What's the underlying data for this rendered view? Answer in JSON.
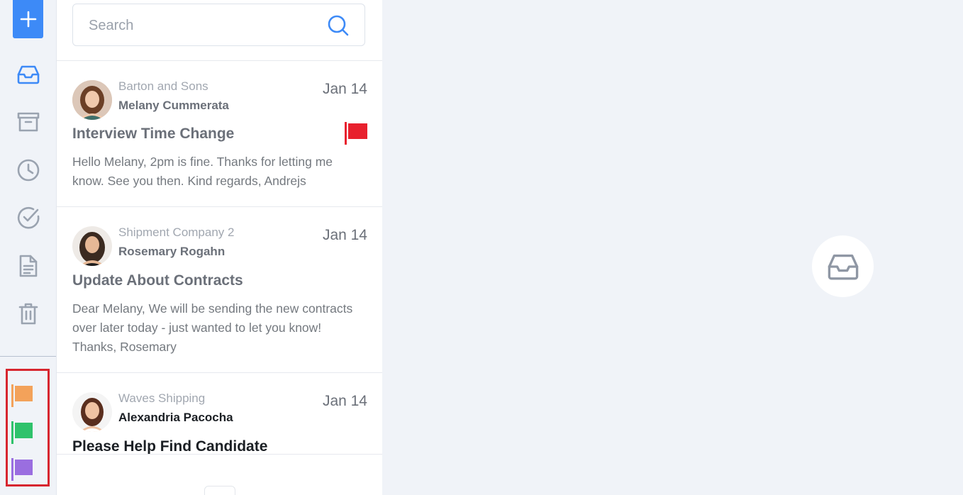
{
  "rail": {
    "compose_icon": "plus-icon",
    "nav": [
      {
        "name": "inbox",
        "icon": "inbox-icon",
        "color": "#3d8af7"
      },
      {
        "name": "archive",
        "icon": "archive-icon",
        "color": "#9aa3b0"
      },
      {
        "name": "snoozed",
        "icon": "clock-icon",
        "color": "#9aa3b0"
      },
      {
        "name": "done",
        "icon": "check-circle-icon",
        "color": "#9aa3b0"
      },
      {
        "name": "drafts",
        "icon": "document-icon",
        "color": "#9aa3b0"
      },
      {
        "name": "trash",
        "icon": "trash-icon",
        "color": "#9aa3b0"
      }
    ],
    "flags": [
      {
        "name": "orange",
        "color": "#f3a25a"
      },
      {
        "name": "green",
        "color": "#2fc26b"
      },
      {
        "name": "purple",
        "color": "#9a6ee0"
      }
    ]
  },
  "search": {
    "placeholder": "Search"
  },
  "messages": [
    {
      "company": "Barton and Sons",
      "sender": "Melany Cummerata",
      "date": "Jan 14",
      "subject": "Interview Time Change",
      "preview": "Hello Melany, 2pm is fine. Thanks for letting me know. See you then. Kind regards, Andrejs",
      "flag_color": "#e8202d"
    },
    {
      "company": "Shipment Company 2",
      "sender": "Rosemary Rogahn",
      "date": "Jan 14",
      "subject": "Update About Contracts",
      "preview": "Dear Melany, We will be sending the new contracts over later today - just wanted to let you know! Thanks, Rosemary"
    },
    {
      "company": "Waves Shipping",
      "sender": "Alexandria Pacocha",
      "date": "Jan 14",
      "subject": "Please Help Find Candidate"
    }
  ],
  "empty_state_icon": "inbox-icon",
  "colors": {
    "accent": "#3d8af7",
    "highlight_border": "#d7262f"
  }
}
